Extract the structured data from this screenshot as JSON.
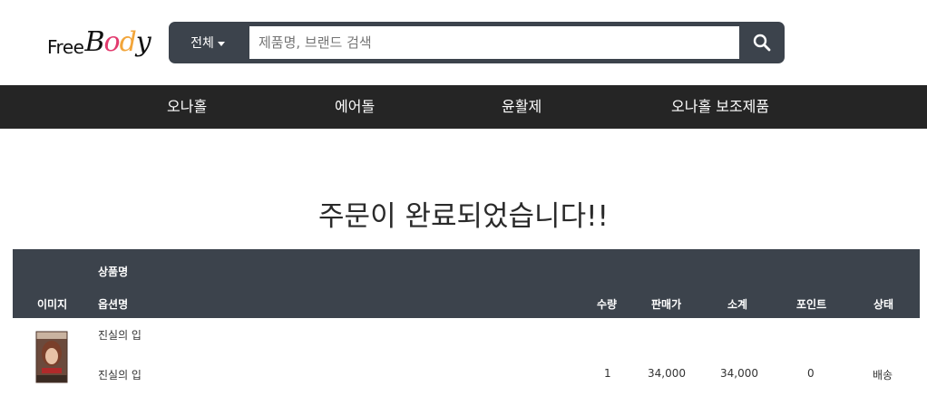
{
  "header": {
    "logo_alt": "FreeBody",
    "search": {
      "scope_label": "전체",
      "placeholder": "제품명, 브랜드 검색",
      "value": ""
    }
  },
  "nav": {
    "items": [
      {
        "label": "오나홀"
      },
      {
        "label": "에어돌"
      },
      {
        "label": "윤활제"
      },
      {
        "label": "오나홀 보조제품"
      }
    ]
  },
  "main": {
    "title": "주문이 완료되었습니다!!"
  },
  "order_table": {
    "headers": {
      "image": "이미지",
      "product_name": "상품명",
      "option_name": "옵션명",
      "quantity": "수량",
      "price": "판매가",
      "subtotal": "소계",
      "points": "포인트",
      "status": "상태"
    },
    "rows": [
      {
        "product_name": "진실의 입",
        "option_name": "진실의 입",
        "quantity": "1",
        "price": "34,000",
        "subtotal": "34,000",
        "points": "0",
        "status": "배송"
      }
    ]
  },
  "colors": {
    "search_bar": "#3c434c",
    "nav_bg": "#252525",
    "table_header_bg": "#3c434c"
  },
  "icons": {
    "search": "search-icon",
    "scope_caret": "caret-down-icon"
  }
}
